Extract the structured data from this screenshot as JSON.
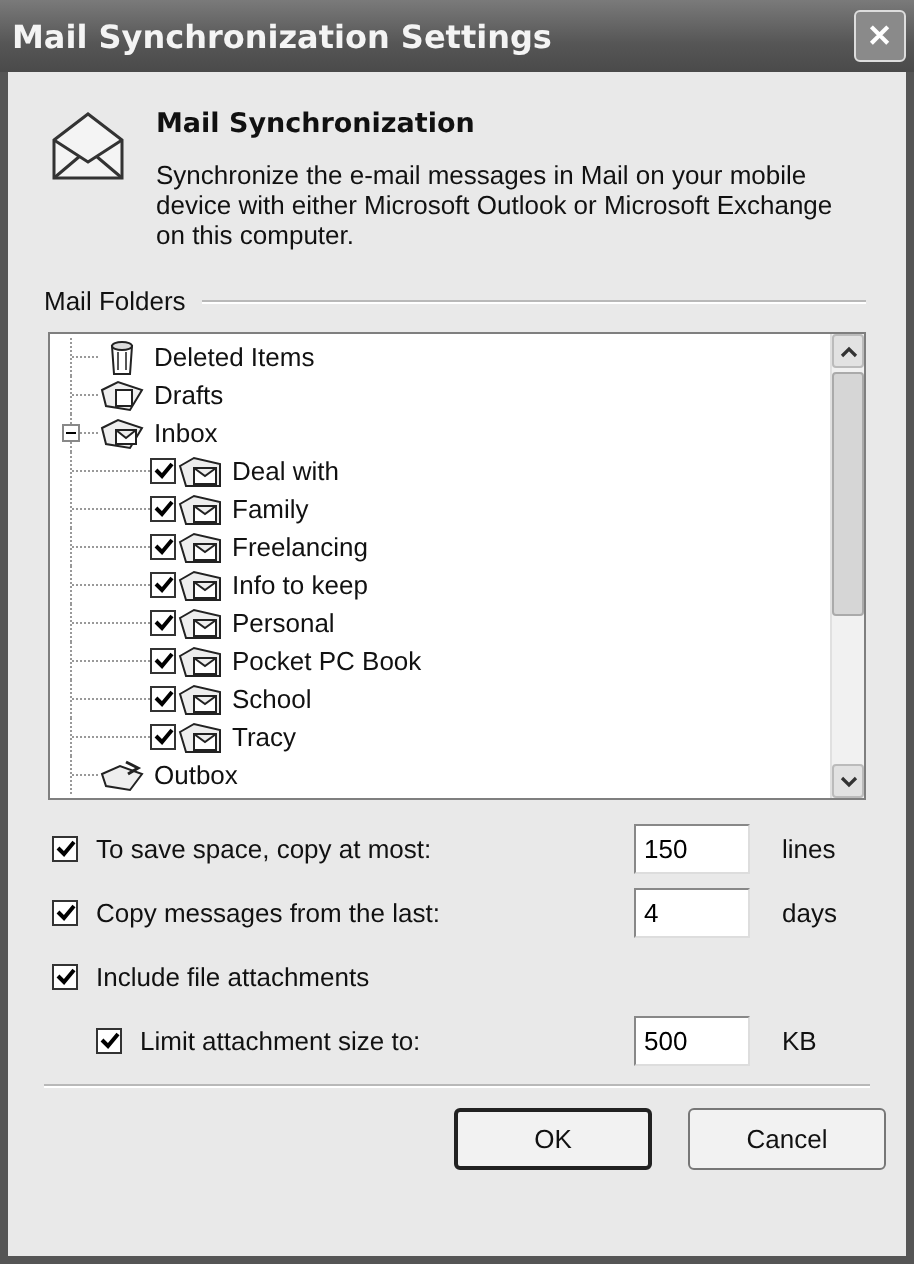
{
  "window": {
    "title": "Mail Synchronization Settings",
    "close": "✕"
  },
  "header": {
    "title": "Mail Synchronization",
    "description": "Synchronize the e-mail messages in Mail on your mobile device with either Microsoft Outlook or Microsoft Exchange on this computer."
  },
  "folders": {
    "label": "Mail Folders",
    "items": [
      {
        "label": "Deleted Items",
        "kind": "trash"
      },
      {
        "label": "Drafts",
        "kind": "drafts"
      },
      {
        "label": "Inbox",
        "kind": "inbox",
        "expanded": true,
        "children": [
          {
            "label": "Deal with",
            "kind": "folder",
            "checked": true
          },
          {
            "label": "Family",
            "kind": "folder",
            "checked": true
          },
          {
            "label": "Freelancing",
            "kind": "folder",
            "checked": true
          },
          {
            "label": "Info to keep",
            "kind": "folder",
            "checked": true
          },
          {
            "label": "Personal",
            "kind": "folder",
            "checked": true
          },
          {
            "label": "Pocket PC Book",
            "kind": "folder",
            "checked": true
          },
          {
            "label": "School",
            "kind": "folder",
            "checked": true
          },
          {
            "label": "Tracy",
            "kind": "folder",
            "checked": true
          }
        ]
      },
      {
        "label": "Outbox",
        "kind": "outbox"
      }
    ]
  },
  "options": [
    {
      "label": "To save space, copy at most:",
      "checked": true,
      "value": "150",
      "unit": "lines"
    },
    {
      "label": "Copy messages from the last:",
      "checked": true,
      "value": "4",
      "unit": "days"
    },
    {
      "label": "Include file attachments",
      "checked": true,
      "children": [
        {
          "label": "Limit attachment size to:",
          "checked": true,
          "value": "500",
          "unit": "KB"
        }
      ]
    }
  ],
  "buttons": [
    {
      "label": "OK",
      "default": true
    },
    {
      "label": "Cancel",
      "default": false
    }
  ]
}
